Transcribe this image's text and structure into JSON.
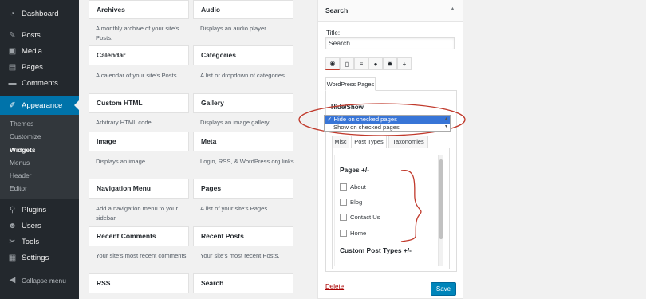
{
  "sidebar": {
    "items": [
      {
        "label": "Dashboard",
        "icon": "dashboard-icon"
      },
      {
        "label": "Posts",
        "icon": "pin-icon"
      },
      {
        "label": "Media",
        "icon": "media-icon"
      },
      {
        "label": "Pages",
        "icon": "pages-icon"
      },
      {
        "label": "Comments",
        "icon": "comments-icon"
      },
      {
        "label": "Appearance",
        "icon": "brush-icon"
      },
      {
        "label": "Plugins",
        "icon": "plugin-icon"
      },
      {
        "label": "Users",
        "icon": "users-icon"
      },
      {
        "label": "Tools",
        "icon": "wrench-icon"
      },
      {
        "label": "Settings",
        "icon": "settings-icon"
      },
      {
        "label": "Collapse menu",
        "icon": "collapse-icon"
      }
    ],
    "submenu": [
      "Themes",
      "Customize",
      "Widgets",
      "Menus",
      "Header",
      "Editor"
    ],
    "accent": "#0073aa"
  },
  "widgets": [
    {
      "title": "Archives",
      "desc": "A monthly archive of your site's Posts."
    },
    {
      "title": "Audio",
      "desc": "Displays an audio player."
    },
    {
      "title": "Calendar",
      "desc": "A calendar of your site's Posts."
    },
    {
      "title": "Categories",
      "desc": "A list or dropdown of categories."
    },
    {
      "title": "Custom HTML",
      "desc": "Arbitrary HTML code."
    },
    {
      "title": "Gallery",
      "desc": "Displays an image gallery."
    },
    {
      "title": "Image",
      "desc": "Displays an image."
    },
    {
      "title": "Meta",
      "desc": "Login, RSS, & WordPress.org links."
    },
    {
      "title": "Navigation Menu",
      "desc": "Add a navigation menu to your sidebar."
    },
    {
      "title": "Pages",
      "desc": "A list of your site's Pages."
    },
    {
      "title": "Recent Comments",
      "desc": "Your site's most recent comments."
    },
    {
      "title": "Recent Posts",
      "desc": "Your site's most recent Posts."
    },
    {
      "title": "RSS",
      "desc": ""
    },
    {
      "title": "Search",
      "desc": ""
    }
  ],
  "panel": {
    "header": "Search",
    "title_label": "Title:",
    "title_value": "Search",
    "icon_tabs": [
      "eye-icon",
      "mobile-icon",
      "align-icon",
      "user-icon",
      "gear-icon",
      "plus-icon"
    ],
    "section_tab": "WordPress Pages",
    "hide_show_label": "Hide/Show",
    "options": [
      "Hide on checked pages",
      "Show on checked pages"
    ],
    "checkmark": "✓",
    "inner_tabs": [
      "Misc",
      "Post Types",
      "Taxonomies"
    ],
    "pages_heading": "Pages +/-",
    "pages": [
      "About",
      "Blog",
      "Contact Us",
      "Home"
    ],
    "custom_types_heading": "Custom Post Types +/-",
    "delete_label": "Delete",
    "save_label": "Save",
    "annotation_color": "#c0392b"
  }
}
